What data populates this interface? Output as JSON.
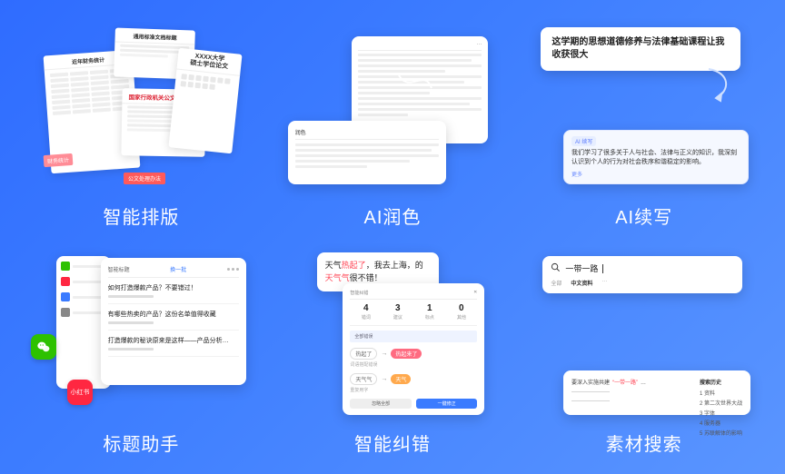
{
  "tiles": {
    "layout": {
      "label": "智能排版"
    },
    "polish": {
      "label": "AI润色"
    },
    "continue": {
      "label": "AI续写"
    },
    "title": {
      "label": "标题助手"
    },
    "correct": {
      "label": "智能纠错"
    },
    "search": {
      "label": "素材搜索"
    }
  },
  "layout_preview": {
    "doc1_title": "近年财务统计",
    "doc1_tag": "财务统计",
    "doc2_title": "通用标准文档标题",
    "doc3_title": "国家行政机关公文处理办法",
    "doc3_tag": "公文处理办法",
    "doc4_title_line1": "XXXX大学",
    "doc4_title_line2": "硕士学位论文"
  },
  "polish_preview": {
    "back_bar": "···",
    "front_title": "润色"
  },
  "continue_preview": {
    "input": "这学期的思想道德修养与法律基础课程让我收获很大",
    "out_tag": "AI 续写",
    "out_body": "我们学习了很多关于人与社会、法律与正义的知识，我深刻认识到个人的行为对社会秩序和谐稳定的影响。",
    "out_link": "更多"
  },
  "title_preview": {
    "side_items": [
      {
        "color": "#2dc100"
      },
      {
        "color": "#ff2741"
      },
      {
        "color": "#3a7bff"
      },
      {
        "color": "#888888"
      }
    ],
    "wechat_label": "微信",
    "xhs_label": "小红书",
    "main_header_left": "智能标题",
    "main_header_right": "换一批",
    "entries": [
      "如何打造爆款产品？不要错过！",
      "有哪些热卖的产品？这份名单值得收藏",
      "打造爆款的秘诀原来是这样——产品分析…"
    ]
  },
  "correct_preview": {
    "sentence_pre": "天气",
    "sentence_err1": "热起了",
    "sentence_mid": "，我去上海，的",
    "sentence_err2": "天气气",
    "sentence_post": "很不错！",
    "panel_header": "智能纠错",
    "stats": [
      {
        "num": "4",
        "label": "错词"
      },
      {
        "num": "3",
        "label": "建议"
      },
      {
        "num": "1",
        "label": "标点"
      },
      {
        "num": "0",
        "label": "其他"
      }
    ],
    "group_bar": "全部错误",
    "corrections": [
      {
        "old": "热起了",
        "new": "热起来了",
        "cls": "r",
        "reason": "词语搭配错误"
      },
      {
        "old": "天气气",
        "new": "天气",
        "cls": "o",
        "reason": "重复用字"
      }
    ],
    "btn_ignore": "忽略全部",
    "btn_apply": "一键修正"
  },
  "search_preview": {
    "icon": "search-icon",
    "query": "一带一路",
    "tabs": [
      "全部",
      "中文资料",
      "···"
    ],
    "active_tab": 1,
    "result_pre": "要深入实施共建",
    "result_kw": "“一带一路”",
    "result_post": "…",
    "side_header": "搜索历史",
    "side_items": [
      "1 资料",
      "2 第二次世界大战",
      "3 字体",
      "4 服务器",
      "5 苏联解体的影响"
    ]
  }
}
